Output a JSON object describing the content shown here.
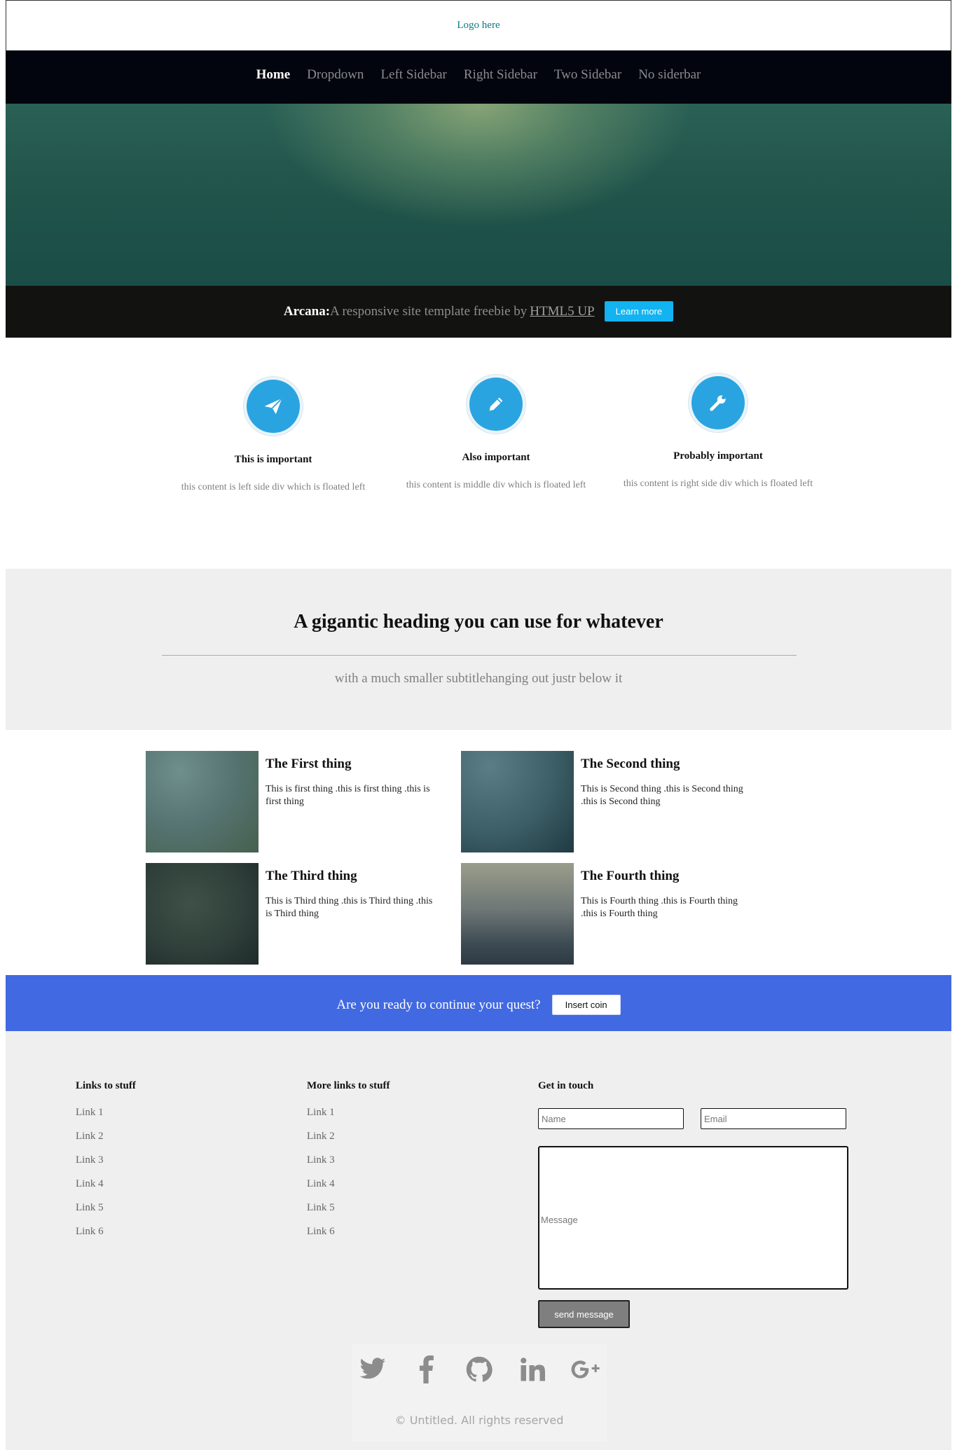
{
  "header": {
    "logo": "Logo here"
  },
  "nav": {
    "items": [
      {
        "label": "Home",
        "active": true
      },
      {
        "label": "Dropdown",
        "active": false
      },
      {
        "label": "Left Sidebar",
        "active": false
      },
      {
        "label": "Right Sidebar",
        "active": false
      },
      {
        "label": "Two Sidebar",
        "active": false
      },
      {
        "label": "No siderbar",
        "active": false
      }
    ]
  },
  "banner": {
    "brand": "Arcana:",
    "text": "A responsive site template freebie by",
    "link": "HTML5 UP",
    "button": "Learn more"
  },
  "features": [
    {
      "icon": "paper-plane-icon",
      "title": "This is important",
      "text": "this content is left side div which is floated left"
    },
    {
      "icon": "pencil-icon",
      "title": "Also important",
      "text": "this content is middle div which is floated left"
    },
    {
      "icon": "wrench-icon",
      "title": "Probably important",
      "text": "this content is right side div which is floated left"
    }
  ],
  "intro": {
    "heading": "A gigantic heading you can use for whatever",
    "subtitle": "with a much smaller subtitlehanging out justr below it"
  },
  "things": [
    {
      "title": "The First thing",
      "text": "This is first thing .this is first thing .this is first thing"
    },
    {
      "title": "The Second thing",
      "text": "This is Second thing .this is Second thing .this is Second thing"
    },
    {
      "title": "The Third thing",
      "text": "This is Third thing .this is Third thing .this is Third thing"
    },
    {
      "title": "The Fourth thing",
      "text": "This is Fourth thing .this is Fourth thing .this is Fourth thing"
    }
  ],
  "cta": {
    "text": "Are you ready to continue your quest?",
    "button": "Insert coin"
  },
  "footer": {
    "col1": {
      "title": "Links to stuff",
      "links": [
        "Link 1",
        "Link 2",
        "Link 3",
        "Link 4",
        "Link 5",
        "Link 6"
      ]
    },
    "col2": {
      "title": "More links to stuff",
      "links": [
        "Link 1",
        "Link 2",
        "Link 3",
        "Link 4",
        "Link 5",
        "Link 6"
      ]
    },
    "contact": {
      "title": "Get in touch",
      "name_placeholder": "Name",
      "email_placeholder": "Email",
      "message_placeholder": "Message",
      "button": "send message"
    },
    "social": [
      "twitter-icon",
      "facebook-icon",
      "github-icon",
      "linkedin-icon",
      "google-plus-icon"
    ],
    "copyright": "© Untitled. All rights reserved"
  },
  "colors": {
    "nav_bg": "#02050d",
    "banner_bg": "#121310",
    "accent_button": "#12b3f0",
    "feature_icon": "#2aa4e0",
    "cta_bg": "#4169e1",
    "footer_bg": "#efefef"
  }
}
